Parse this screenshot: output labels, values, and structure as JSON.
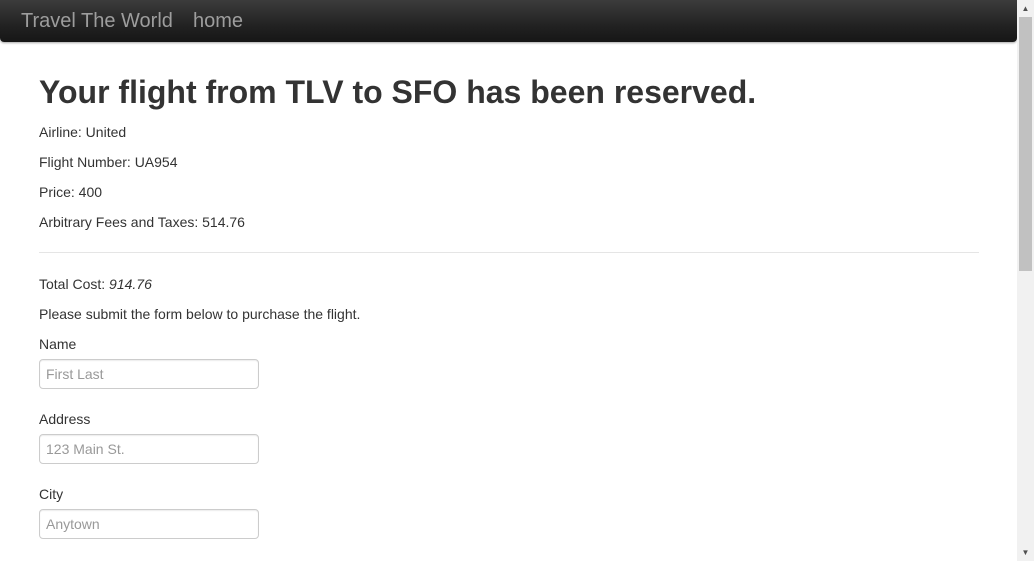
{
  "navbar": {
    "brand": "Travel The World",
    "home_link": "home"
  },
  "confirmation": {
    "heading": "Your flight from TLV to SFO has been reserved.",
    "airline": "Airline: United",
    "flight_number": "Flight Number: UA954",
    "price": "Price: 400",
    "fees": "Arbitrary Fees and Taxes: 514.76"
  },
  "summary": {
    "total_label": "Total Cost: ",
    "total_value": "914.76",
    "instructions": "Please submit the form below to purchase the flight."
  },
  "form": {
    "name_label": "Name",
    "name_placeholder": "First Last",
    "address_label": "Address",
    "address_placeholder": "123 Main St.",
    "city_label": "City",
    "city_placeholder": "Anytown"
  }
}
